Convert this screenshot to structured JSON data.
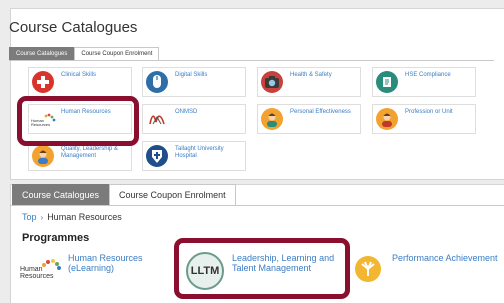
{
  "page_title": "Course Catalogues",
  "tabs_top": [
    "Course Catalogues",
    "Course Coupon Enrolment"
  ],
  "catalogue_tiles": [
    {
      "label": "Clinical Skills",
      "icon": "plus-icon"
    },
    {
      "label": "Digital Skills",
      "icon": "mouse-icon"
    },
    {
      "label": "Health & Safety",
      "icon": "camera-icon"
    },
    {
      "label": "HSE Compliance",
      "icon": "document-icon"
    },
    {
      "label": "Human Resources",
      "icon": "human-resources-logo"
    },
    {
      "label": "ONMSD",
      "icon": "onmsd-logo"
    },
    {
      "label": "Personal Effectiveness",
      "icon": "person-icon"
    },
    {
      "label": "Profession or Unit",
      "icon": "person-icon"
    },
    {
      "label": "Quality, Leadership & Management",
      "icon": "person-icon"
    },
    {
      "label": "Tallaght University Hospital",
      "icon": "hospital-crest-icon"
    }
  ],
  "tabs_bottom": [
    "Course Catalogues",
    "Course Coupon Enrolment"
  ],
  "breadcrumb": {
    "top": "Top",
    "separator": "›",
    "current": "Human Resources"
  },
  "programmes_heading": "Programmes",
  "programmes": [
    {
      "label": "Human Resources (eLearning)",
      "icon": "human-resources-logo"
    },
    {
      "label": "Leadership, Learning and Talent Management",
      "icon": "lltm-logo"
    },
    {
      "label": "Performance Achievement",
      "icon": "performance-icon"
    }
  ],
  "logos": {
    "hr_text_line1": "Human",
    "hr_text_line2": "Resources",
    "lltm_text": "LLTM"
  },
  "colors": {
    "highlight": "#8a0f2e",
    "link": "#3b7dc4",
    "active_tab": "#7b7b7b"
  }
}
